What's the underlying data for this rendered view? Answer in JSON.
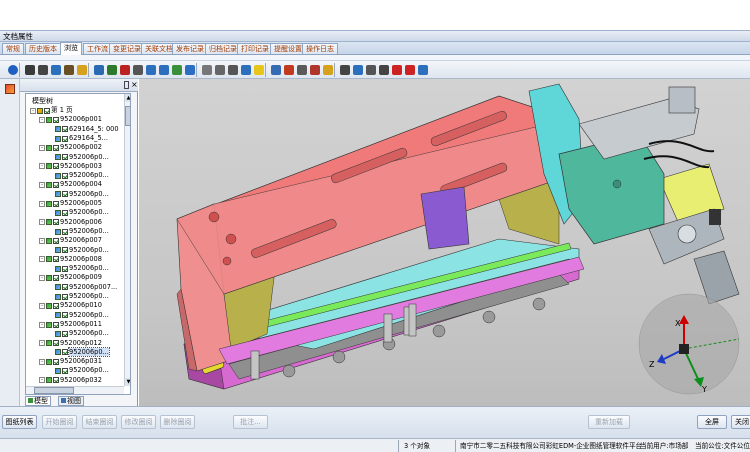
{
  "window": {
    "title": "文档属性"
  },
  "tabs": [
    {
      "label": "常规",
      "active": false
    },
    {
      "label": "历史版本",
      "active": false
    },
    {
      "label": "浏览",
      "active": true
    },
    {
      "label": "工作流",
      "active": false
    },
    {
      "label": "变更记录",
      "active": false
    },
    {
      "label": "关联文档",
      "active": false
    },
    {
      "label": "发布记录",
      "active": false
    },
    {
      "label": "归档记录",
      "active": false
    },
    {
      "label": "打印记录",
      "active": false
    },
    {
      "label": "提醒设置",
      "active": false
    },
    {
      "label": "操作日志",
      "active": false
    }
  ],
  "toolbar": {
    "icons": [
      "info-icon",
      "cube-icon",
      "print-icon",
      "layers-icon",
      "edit-icon",
      "folder-icon",
      "search-icon",
      "zoom-in-icon",
      "zoom-out-icon",
      "pan-icon",
      "zoom-window-icon",
      "zoom-fit-icon",
      "rotate-icon",
      "refresh-icon",
      "section-icon",
      "lines-icon",
      "measure-icon",
      "tree-icon",
      "lightbulb-icon",
      "view-icon",
      "render-icon",
      "mesh-icon",
      "shaded-icon",
      "color-icon",
      "camera-icon",
      "front-view-icon",
      "grid-view-icon",
      "dimension-icon",
      "markup-icon",
      "close-markup-icon",
      "settings-icon"
    ]
  },
  "tree_panel": {
    "title": "模型树",
    "nodes": [
      {
        "label": "第 1 页",
        "level": 0,
        "expand": "-",
        "type": "page"
      },
      {
        "label": "952006p001",
        "level": 1,
        "expand": "-",
        "type": "asm"
      },
      {
        "label": "629164_5: 000",
        "level": 2,
        "expand": "",
        "type": "part"
      },
      {
        "label": "629164_5...",
        "level": 2,
        "expand": "",
        "type": "part"
      },
      {
        "label": "952006p002",
        "level": 1,
        "expand": "-",
        "type": "asm"
      },
      {
        "label": "952006p0...",
        "level": 2,
        "expand": "",
        "type": "part"
      },
      {
        "label": "952006p003",
        "level": 1,
        "expand": "-",
        "type": "asm"
      },
      {
        "label": "952006p0...",
        "level": 2,
        "expand": "",
        "type": "part"
      },
      {
        "label": "952006p004",
        "level": 1,
        "expand": "-",
        "type": "asm"
      },
      {
        "label": "952006p0...",
        "level": 2,
        "expand": "",
        "type": "part"
      },
      {
        "label": "952006p005",
        "level": 1,
        "expand": "-",
        "type": "asm"
      },
      {
        "label": "952006p0...",
        "level": 2,
        "expand": "",
        "type": "part"
      },
      {
        "label": "952006p006",
        "level": 1,
        "expand": "-",
        "type": "asm"
      },
      {
        "label": "952006p0...",
        "level": 2,
        "expand": "",
        "type": "part"
      },
      {
        "label": "952006p007",
        "level": 1,
        "expand": "-",
        "type": "asm"
      },
      {
        "label": "952006p0...",
        "level": 2,
        "expand": "",
        "type": "part"
      },
      {
        "label": "952006p008",
        "level": 1,
        "expand": "-",
        "type": "asm"
      },
      {
        "label": "952006p0...",
        "level": 2,
        "expand": "",
        "type": "part"
      },
      {
        "label": "952006p009",
        "level": 1,
        "expand": "-",
        "type": "asm"
      },
      {
        "label": "952006p007...",
        "level": 2,
        "expand": "",
        "type": "part"
      },
      {
        "label": "952006p0...",
        "level": 2,
        "expand": "",
        "type": "part"
      },
      {
        "label": "952006p010",
        "level": 1,
        "expand": "-",
        "type": "asm"
      },
      {
        "label": "952006p0...",
        "level": 2,
        "expand": "",
        "type": "part"
      },
      {
        "label": "952006p011",
        "level": 1,
        "expand": "-",
        "type": "asm"
      },
      {
        "label": "952006p0...",
        "level": 2,
        "expand": "",
        "type": "part"
      },
      {
        "label": "952006p012",
        "level": 1,
        "expand": "-",
        "type": "asm"
      },
      {
        "label": "952006p0...",
        "level": 2,
        "expand": "",
        "type": "part",
        "selected": true
      },
      {
        "label": "952006p031",
        "level": 1,
        "expand": "-",
        "type": "asm"
      },
      {
        "label": "952006p0...",
        "level": 2,
        "expand": "",
        "type": "part"
      },
      {
        "label": "952006p032",
        "level": 1,
        "expand": "-",
        "type": "asm"
      },
      {
        "label": "952006p0...",
        "level": 2,
        "expand": "",
        "type": "part"
      }
    ],
    "tabs": [
      {
        "label": "模型",
        "active": true
      },
      {
        "label": "视图",
        "active": false
      }
    ]
  },
  "axes": {
    "x": "X",
    "y": "Y",
    "z": "Z"
  },
  "buttons": {
    "left": [
      {
        "label": "图纸列表",
        "enabled": true
      },
      {
        "label": "开始圈阅",
        "enabled": false
      },
      {
        "label": "结束圈阅",
        "enabled": false
      },
      {
        "label": "修改圈阅",
        "enabled": false
      },
      {
        "label": "删除圈阅",
        "enabled": false
      },
      {
        "label": "批注...",
        "enabled": false
      }
    ],
    "reload": {
      "label": "重新加载",
      "enabled": false
    },
    "fullscreen": {
      "label": "全屏",
      "enabled": true
    },
    "close": {
      "label": "关闭",
      "enabled": true
    }
  },
  "status": {
    "count": "3 个对象",
    "company": "南宁市二零二五科技有限公司彩虹EDM-企业图纸管理软件平台",
    "user": "当前用户:市场部",
    "unit": "当前公位:文件公位"
  }
}
